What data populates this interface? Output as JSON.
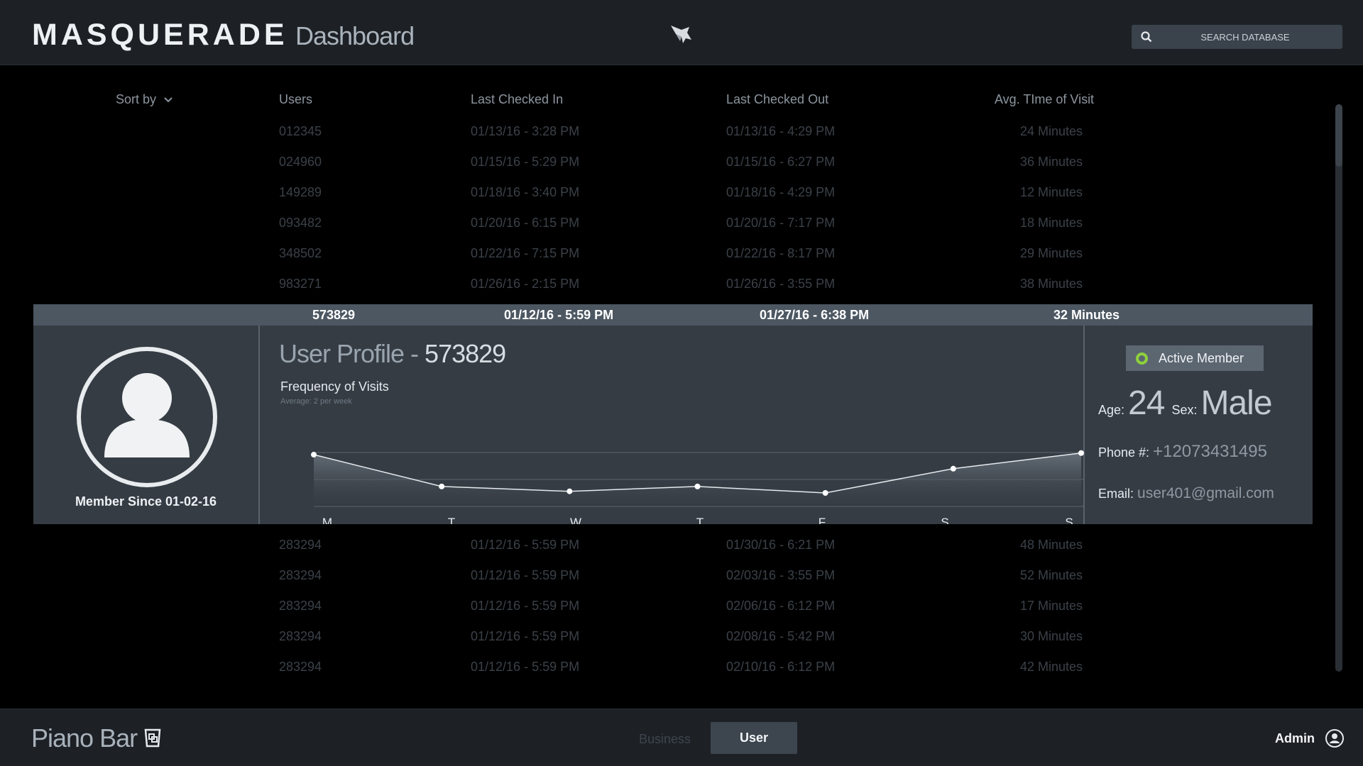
{
  "header": {
    "brand": "MASQUERADE",
    "brand_sub": "Dashboard",
    "search_placeholder": "SEARCH DATABASE"
  },
  "table": {
    "sort_label": "Sort by",
    "columns": [
      "Users",
      "Last Checked In",
      "Last Checked Out",
      "Avg. TIme of  Visit"
    ],
    "rows_above": [
      [
        "012345",
        "01/13/16 - 3:28 PM",
        "01/13/16 - 4:29 PM",
        "24 Minutes"
      ],
      [
        "024960",
        "01/15/16 - 5:29 PM",
        "01/15/16 - 6:27 PM",
        "36 Minutes"
      ],
      [
        "149289",
        "01/18/16 - 3:40 PM",
        "01/18/16 - 4:29 PM",
        "12 Minutes"
      ],
      [
        "093482",
        "01/20/16 - 6:15 PM",
        "01/20/16 - 7:17 PM",
        "18 Minutes"
      ],
      [
        "348502",
        "01/22/16 - 7:15 PM",
        "01/22/16 - 8:17 PM",
        "29 Minutes"
      ],
      [
        "983271",
        "01/26/16 - 2:15 PM",
        "01/26/16 - 3:55 PM",
        "38 Minutes"
      ]
    ],
    "selected_row": [
      "573829",
      "01/12/16 - 5:59 PM",
      "01/27/16 - 6:38 PM",
      "32 Minutes"
    ],
    "rows_below": [
      [
        "283294",
        "01/12/16 - 5:59 PM",
        "01/30/16 - 6:21 PM",
        "48 Minutes"
      ],
      [
        "283294",
        "01/12/16 - 5:59 PM",
        "02/03/16 - 3:55 PM",
        "52 Minutes"
      ],
      [
        "283294",
        "01/12/16 - 5:59 PM",
        "02/06/16 - 6:12 PM",
        "17 Minutes"
      ],
      [
        "283294",
        "01/12/16 - 5:59 PM",
        "02/08/16 - 5:42 PM",
        "30 Minutes"
      ],
      [
        "283294",
        "01/12/16 - 5:59 PM",
        "02/10/16 - 6:12 PM",
        "42 Minutes"
      ]
    ]
  },
  "profile": {
    "member_since": "Member Since 01-02-16",
    "title_prefix": "User Profile - ",
    "user_id": "573829",
    "chart_title": "Frequency of Visits",
    "chart_subtitle": "Average: 2 per week",
    "status": "Active Member",
    "age_label": "Age:",
    "age": "24",
    "sex_label": "Sex:",
    "sex": "Male",
    "phone_label": "Phone #:",
    "phone": "+12073431495",
    "email_label": "Email:",
    "email": "user401@gmail.com",
    "status_color": "#8ed13c"
  },
  "chart_data": {
    "type": "area",
    "categories": [
      "M",
      "T",
      "W",
      "T",
      "F",
      "S",
      "S"
    ],
    "values": [
      9.6,
      3.7,
      2.8,
      3.7,
      2.5,
      7.0,
      9.9
    ],
    "ylim": [
      0,
      10
    ],
    "yticks": [
      0,
      5,
      10
    ],
    "grid": true
  },
  "footer": {
    "venue": "Piano Bar",
    "tab_business": "Business",
    "tab_user": "User",
    "admin": "Admin"
  }
}
